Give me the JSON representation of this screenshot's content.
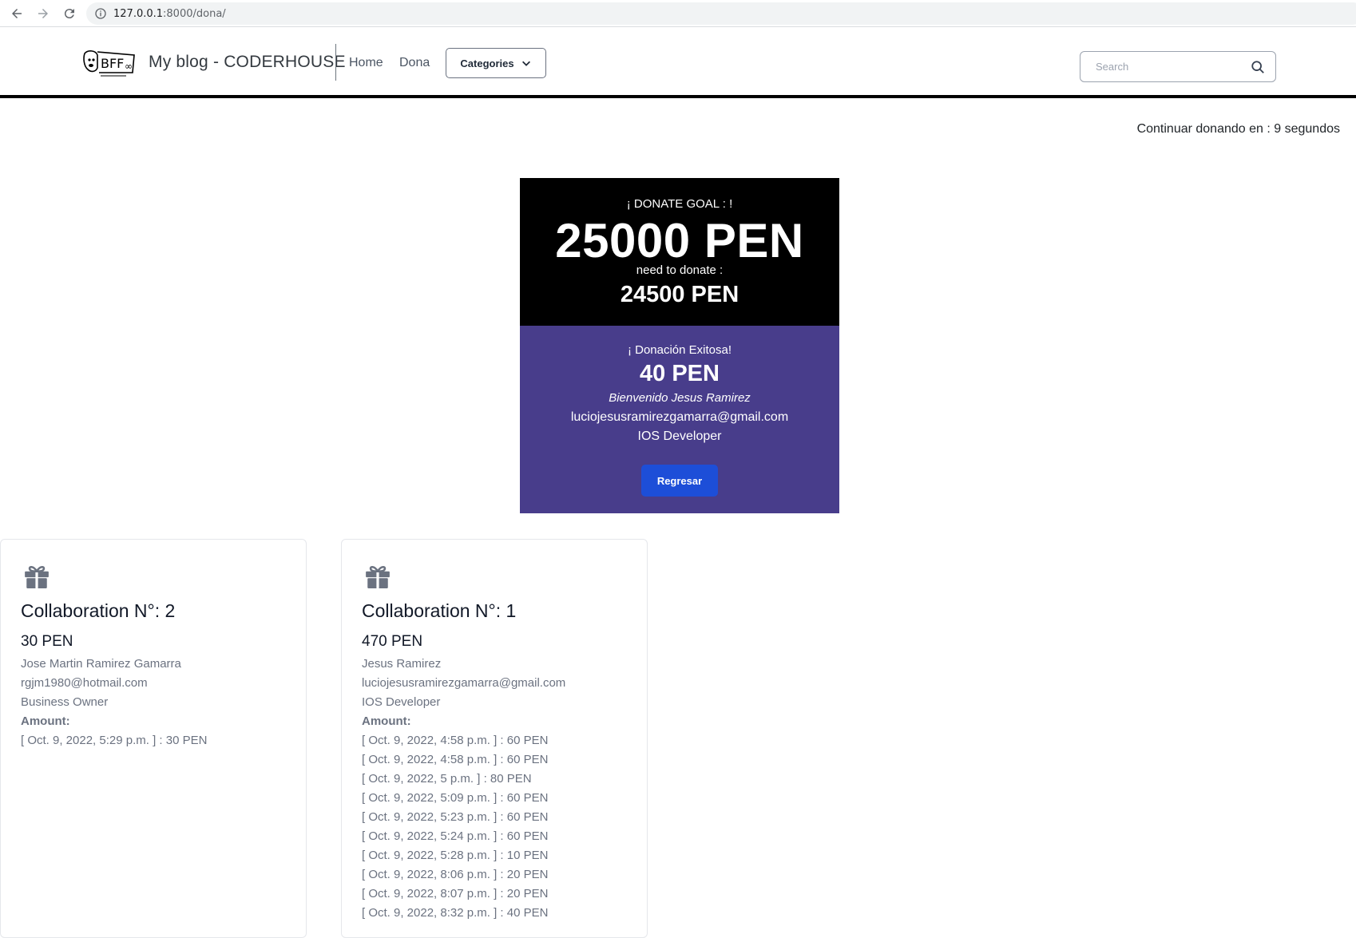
{
  "browser": {
    "url_host": "127.0.0.1",
    "url_path": ":8000/dona/"
  },
  "navbar": {
    "brand_title": "My blog - CODERHOUSE",
    "links": [
      "Home",
      "Dona"
    ],
    "categories_label": "Categories",
    "search_placeholder": "Search"
  },
  "countdown": {
    "prefix": "Continuar donando en : ",
    "seconds": "9",
    "suffix": " segundos"
  },
  "goal": {
    "label": "¡ DONATE GOAL : !",
    "amount": "25000 PEN",
    "need_label": "need to donate :",
    "remaining": "24500 PEN"
  },
  "success": {
    "label": "¡ Donación Exitosa!",
    "amount": "40 PEN",
    "welcome": "Bienvenido Jesus Ramirez",
    "email": "luciojesusramirezgamarra@gmail.com",
    "role": "IOS Developer",
    "back_label": "Regresar"
  },
  "cards": [
    {
      "title": "Collaboration N°: 2",
      "total": "30 PEN",
      "name": "Jose Martin Ramirez Gamarra",
      "email": "rgjm1980@hotmail.com",
      "role": "Business Owner",
      "amount_label": "Amount:",
      "entries": [
        "[ Oct. 9, 2022, 5:29 p.m. ] : 30 PEN"
      ]
    },
    {
      "title": "Collaboration N°: 1",
      "total": "470 PEN",
      "name": "Jesus Ramirez",
      "email": "luciojesusramirezgamarra@gmail.com",
      "role": "IOS Developer",
      "amount_label": "Amount:",
      "entries": [
        "[ Oct. 9, 2022, 4:58 p.m. ] : 60 PEN",
        "[ Oct. 9, 2022, 4:58 p.m. ] : 60 PEN",
        "[ Oct. 9, 2022, 5 p.m. ] : 80 PEN",
        "[ Oct. 9, 2022, 5:09 p.m. ] : 60 PEN",
        "[ Oct. 9, 2022, 5:23 p.m. ] : 60 PEN",
        "[ Oct. 9, 2022, 5:24 p.m. ] : 60 PEN",
        "[ Oct. 9, 2022, 5:28 p.m. ] : 10 PEN",
        "[ Oct. 9, 2022, 8:06 p.m. ] : 20 PEN",
        "[ Oct. 9, 2022, 8:07 p.m. ] : 20 PEN",
        "[ Oct. 9, 2022, 8:32 p.m. ] : 40 PEN"
      ]
    }
  ]
}
